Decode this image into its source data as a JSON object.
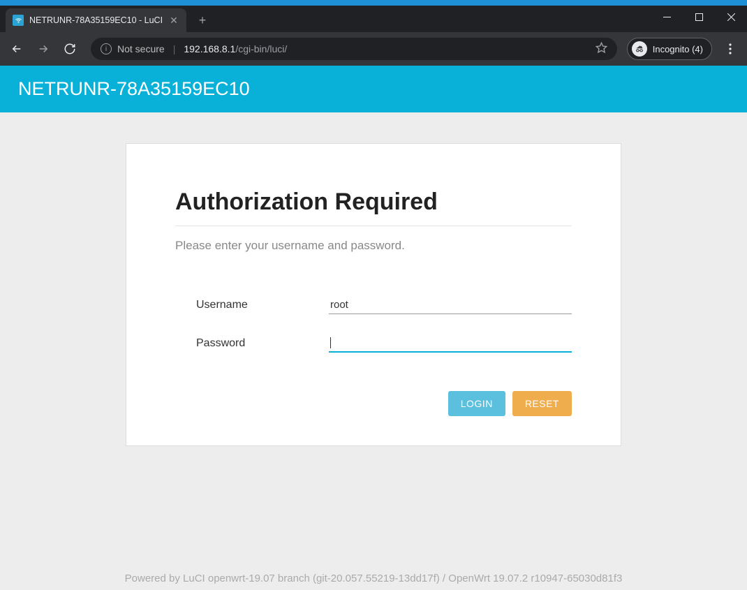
{
  "browser": {
    "tab_title": "NETRUNR-78A35159EC10 - LuCI",
    "security_label": "Not secure",
    "url_host": "192.168.8.1",
    "url_path": "/cgi-bin/luci/",
    "incognito_label": "Incognito (4)"
  },
  "page": {
    "header_title": "NETRUNR-78A35159EC10",
    "card": {
      "title": "Authorization Required",
      "subtitle": "Please enter your username and password.",
      "username_label": "Username",
      "username_value": "root",
      "password_label": "Password",
      "password_value": "",
      "login_button": "LOGIN",
      "reset_button": "RESET"
    },
    "footer": "Powered by LuCI openwrt-19.07 branch (git-20.057.55219-13dd17f) / OpenWrt 19.07.2 r10947-65030d81f3"
  }
}
